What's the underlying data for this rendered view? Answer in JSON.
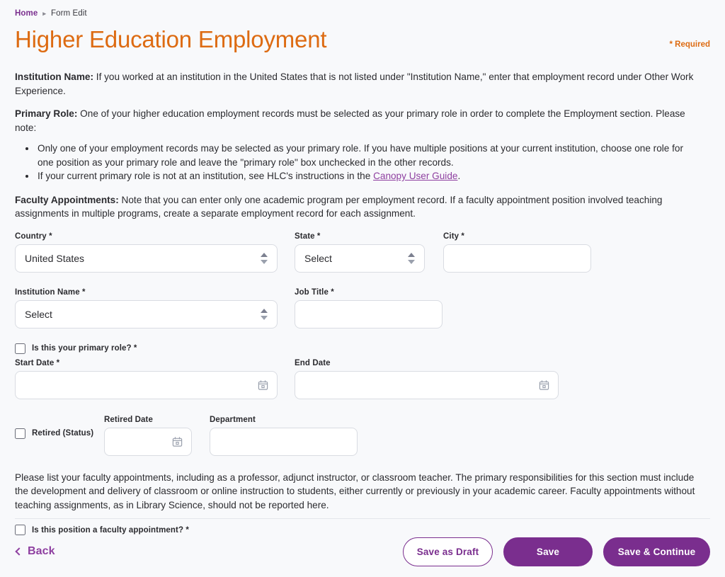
{
  "breadcrumb": {
    "home": "Home",
    "separator": "▸",
    "current": "Form Edit"
  },
  "header": {
    "title": "Higher Education Employment",
    "required_note": "* Required",
    "title_color": "#dd6b12",
    "accent_color": "#7a2e8e"
  },
  "intro": {
    "institution_label": "Institution Name:",
    "institution_text": " If you worked at an institution in the United States that is not listed under \"Institution Name,\" enter that employment record under Other Work Experience.",
    "primary_role_label": "Primary Role:",
    "primary_role_text": " One of your higher education employment records must be selected as your primary role in order to complete the Employment section. Please note:",
    "bullets": [
      "Only one of your employment records may be selected as your primary role. If you have multiple positions at your current institution, choose one role for one position as your primary role and leave the \"primary role\" box unchecked in the other records.",
      "If your current primary role is not at an institution, see HLC's instructions in the "
    ],
    "bullet_link_text": "Canopy User Guide",
    "bullet_link_tail": ".",
    "faculty_label": "Faculty Appointments:",
    "faculty_text": " Note that you can enter only one academic program per employment record. If a faculty appointment position involved teaching assignments in multiple programs, create a separate employment record for each assignment."
  },
  "form": {
    "country": {
      "label": "Country *",
      "value": "United States",
      "type": "select"
    },
    "state": {
      "label": "State *",
      "value": "Select",
      "type": "select"
    },
    "city": {
      "label": "City *",
      "value": "",
      "placeholder": "",
      "type": "text"
    },
    "institution_name": {
      "label": "Institution Name *",
      "value": "Select",
      "type": "select"
    },
    "job_title": {
      "label": "Job Title *",
      "value": "",
      "placeholder": "",
      "type": "text"
    },
    "primary_role_checkbox": {
      "label": "Is this your primary role? *",
      "checked": false
    },
    "start_date": {
      "label": "Start Date *",
      "value": "",
      "placeholder": "",
      "type": "date"
    },
    "end_date": {
      "label": "End Date",
      "value": "",
      "placeholder": "",
      "type": "date"
    },
    "retired_checkbox": {
      "label": "Retired (Status)",
      "checked": false
    },
    "retired_date": {
      "label": "Retired Date",
      "value": "",
      "placeholder": "",
      "type": "date"
    },
    "department": {
      "label": "Department",
      "value": "",
      "placeholder": "",
      "type": "text"
    },
    "faculty_note": "Please list your faculty appointments, including as a professor, adjunct instructor, or classroom teacher. The primary responsibilities for this section must include the development and delivery of classroom or online instruction to students, either currently or previously in your academic career. Faculty appointments without teaching assignments, as in Library Science, should not be reported here.",
    "faculty_checkbox": {
      "label": "Is this position a faculty appointment? *",
      "checked": false
    }
  },
  "footer": {
    "back": "Back",
    "save_as_draft": "Save as Draft",
    "save": "Save",
    "save_and_continue": "Save & Continue"
  }
}
